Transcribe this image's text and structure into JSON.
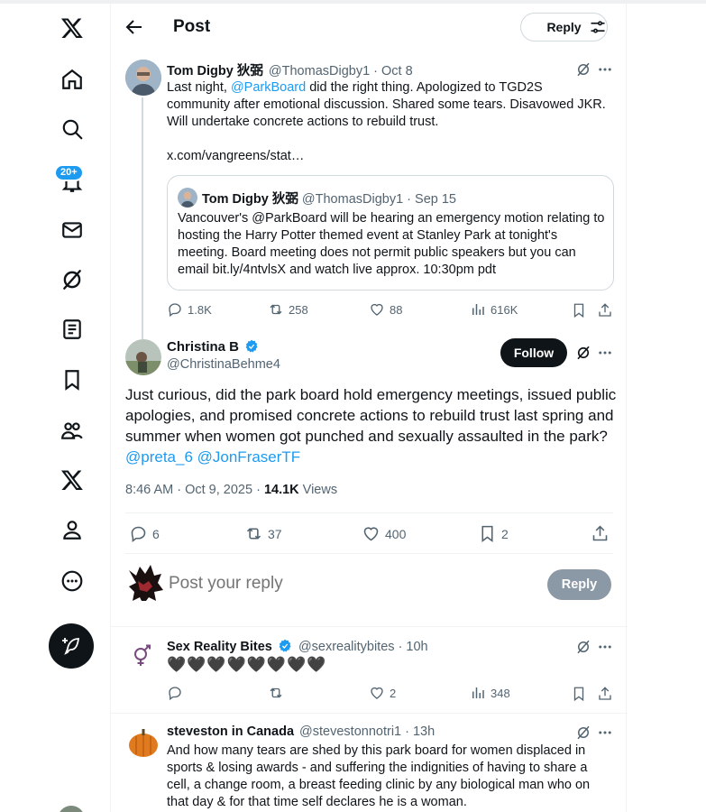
{
  "nav": {
    "items": [
      {
        "name": "x-logo-icon"
      },
      {
        "name": "home-icon"
      },
      {
        "name": "search-icon"
      },
      {
        "name": "notifications-icon"
      },
      {
        "name": "messages-icon"
      },
      {
        "name": "grok-icon"
      },
      {
        "name": "lists-icon"
      },
      {
        "name": "bookmarks-icon"
      },
      {
        "name": "communities-icon"
      },
      {
        "name": "premium-icon"
      },
      {
        "name": "profile-icon"
      },
      {
        "name": "more-icon"
      }
    ],
    "notification_badge": "20+"
  },
  "header": {
    "title": "Post",
    "reply_label": "Reply"
  },
  "parent_tweet": {
    "name": "Tom Digby 狄弼",
    "handle": "@ThomasDigby1",
    "date": "· Oct 8",
    "text_pre": "Last night, ",
    "mention": "@ParkBoard",
    "text_post": " did the right thing.  Apologized to TGD2S community after emotional discussion.  Shared some tears.  Disavowed JKR. Will undertake concrete actions to rebuild trust.",
    "link": "x.com/vangreens/stat…",
    "quote": {
      "name": "Tom Digby 狄弼",
      "handle": "@ThomasDigby1",
      "date": "· Sep 15",
      "text": "Vancouver's @ParkBoard will be hearing an emergency motion relating to hosting the Harry Potter themed event at Stanley Park at tonight's meeting.  Board meeting does not permit public speakers but you can email bit.ly/4ntvlsX and watch live approx. 10:30pm pdt"
    },
    "stats": {
      "replies": "1.8K",
      "reposts": "258",
      "likes": "88",
      "views": "616K"
    }
  },
  "focal_tweet": {
    "name": "Christina B",
    "handle": "@ChristinaBehme4",
    "follow_label": "Follow",
    "text": "Just curious, did the park board hold emergency meetings, issued public apologies, and promised concrete actions to rebuild trust last spring and summer when women got punched and sexually assaulted in the park?",
    "mentions": "@preta_6 @JonFraserTF",
    "timestamp": "8:46 AM · Oct 9, 2025 · ",
    "views_count": "14.1K",
    "views_label": " Views",
    "stats": {
      "replies": "6",
      "reposts": "37",
      "likes": "400",
      "bookmarks": "2"
    }
  },
  "composer": {
    "placeholder": "Post your reply",
    "reply_label": "Reply"
  },
  "replies": [
    {
      "name": "Sex Reality Bites",
      "handle": "@sexrealitybites",
      "date": "· 10h",
      "text": "🖤🖤🖤🖤🖤🖤🖤🖤",
      "stats": {
        "replies": "",
        "reposts": "",
        "likes": "2",
        "views": "348"
      }
    },
    {
      "name": "steveston in Canada",
      "handle": "@stevestonnotri1",
      "date": "· 13h",
      "text": "And how many tears are shed by this park board for women displaced in sports & losing awards - and suffering the indignities of having to share a cell, a change room, a breast feeding clinic by any biological man who on that day & for that time self declares he is a woman."
    }
  ],
  "colors": {
    "accent": "#1d9bf0",
    "text": "#0f1419",
    "muted": "#536471",
    "border": "#cfd9de"
  }
}
